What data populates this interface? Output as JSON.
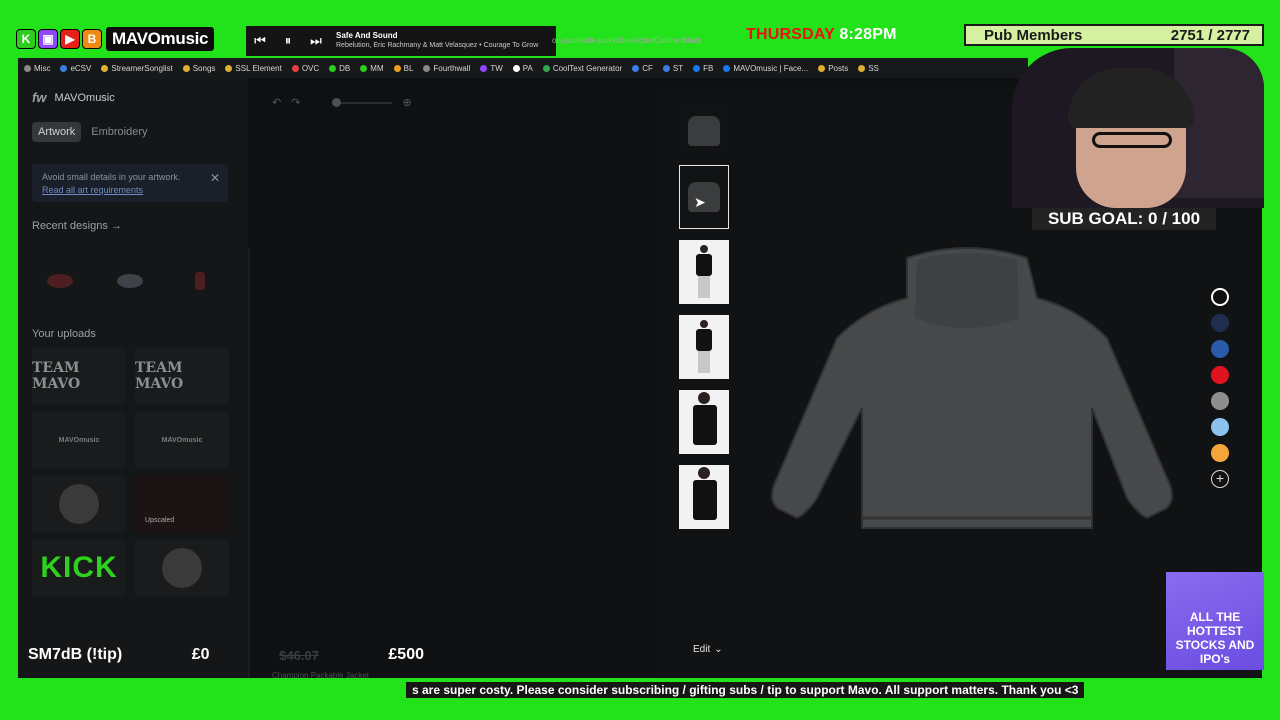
{
  "overlay": {
    "brand_name": "MAVOmusic",
    "brand_icons": [
      {
        "name": "kick-icon",
        "glyph": "K",
        "color": "#2ecc1f"
      },
      {
        "name": "twitch-icon",
        "glyph": "▣",
        "color": "#9146ff"
      },
      {
        "name": "youtube-icon",
        "glyph": "▶",
        "color": "#e62117"
      },
      {
        "name": "b-icon",
        "glyph": "B",
        "color": "#f08a16"
      }
    ],
    "now_playing": {
      "song": "Safe And Sound",
      "artist": "Rebelution, Eric Rachmany & Matt Velasquez • Courage To Grow"
    },
    "url_fragment": "on-packable-jacket&selectedColors=Black",
    "clock_day": "THURSDAY",
    "clock_time": "8:28PM",
    "pub_label": "Pub Members",
    "pub_count": "2751 / 2777",
    "sub_goal": "SUB GOAL: 0 / 100",
    "promo_text": "ALL THE HOTTEST STOCKS AND IPO's",
    "tip_label": "SM7dB (!tip)",
    "tip_current": "£0",
    "tip_goal": "£500",
    "ticker": "s are super costy. Please consider subscribing / gifting subs / tip to support Mavo. All support matters. Thank you <3"
  },
  "bookmarks": [
    {
      "label": "Misc",
      "color": "#888888"
    },
    {
      "label": "eCSV",
      "color": "#3b7de0"
    },
    {
      "label": "StreamerSonglist",
      "color": "#e0b030"
    },
    {
      "label": "Songs",
      "color": "#e0b030"
    },
    {
      "label": "SSL Element",
      "color": "#e0b030"
    },
    {
      "label": "OVC",
      "color": "#e84040"
    },
    {
      "label": "DB",
      "color": "#2ecc1f"
    },
    {
      "label": "MM",
      "color": "#2ecc1f"
    },
    {
      "label": "BL",
      "color": "#f0a020"
    },
    {
      "label": "Fourthwall",
      "color": "#888888"
    },
    {
      "label": "TW",
      "color": "#9146ff"
    },
    {
      "label": "PA",
      "color": "#ffffff"
    },
    {
      "label": "CoolText Generator",
      "color": "#2fa84f"
    },
    {
      "label": "CF",
      "color": "#3b7de0"
    },
    {
      "label": "ST",
      "color": "#3b7de0"
    },
    {
      "label": "FB",
      "color": "#1877f2"
    },
    {
      "label": "MAVOmusic | Face...",
      "color": "#1877f2"
    },
    {
      "label": "Posts",
      "color": "#e0b030"
    },
    {
      "label": "SS",
      "color": "#e0b030"
    }
  ],
  "sidebar": {
    "app_name": "MAVOmusic",
    "logo": "fw",
    "tabs": [
      {
        "label": "Artwork",
        "active": true
      },
      {
        "label": "Embroidery",
        "active": false
      }
    ],
    "notice": {
      "text": "Avoid small details in your artwork.",
      "link": "Read all art requirements"
    },
    "recent_title": "Recent designs",
    "uploads_title": "Your uploads",
    "uploads": [
      {
        "label": "TEAM MAVO",
        "kind": "text"
      },
      {
        "label": "TEAM MAVO",
        "kind": "text"
      },
      {
        "label": "MAVOmusic",
        "kind": "small"
      },
      {
        "label": "MAVOmusic",
        "kind": "small"
      },
      {
        "label": "",
        "kind": "image"
      },
      {
        "label": "Upscaled",
        "kind": "badge"
      },
      {
        "label": "KICK",
        "kind": "kick"
      },
      {
        "label": "",
        "kind": "image"
      }
    ]
  },
  "product": {
    "faint_price": "$46.07",
    "name": "Champion Packable Jacket",
    "edit_label": "Edit"
  },
  "swatches": [
    {
      "name": "black",
      "color": "#111111",
      "selected": true
    },
    {
      "name": "navy",
      "color": "#1f2e4f",
      "selected": false
    },
    {
      "name": "royal",
      "color": "#2b5aa8",
      "selected": false
    },
    {
      "name": "red",
      "color": "#e0141e",
      "selected": false
    },
    {
      "name": "grey",
      "color": "#8e8e8e",
      "selected": false
    },
    {
      "name": "light-blue",
      "color": "#8ec2ee",
      "selected": false
    },
    {
      "name": "orange",
      "color": "#f3a53a",
      "selected": false
    }
  ]
}
